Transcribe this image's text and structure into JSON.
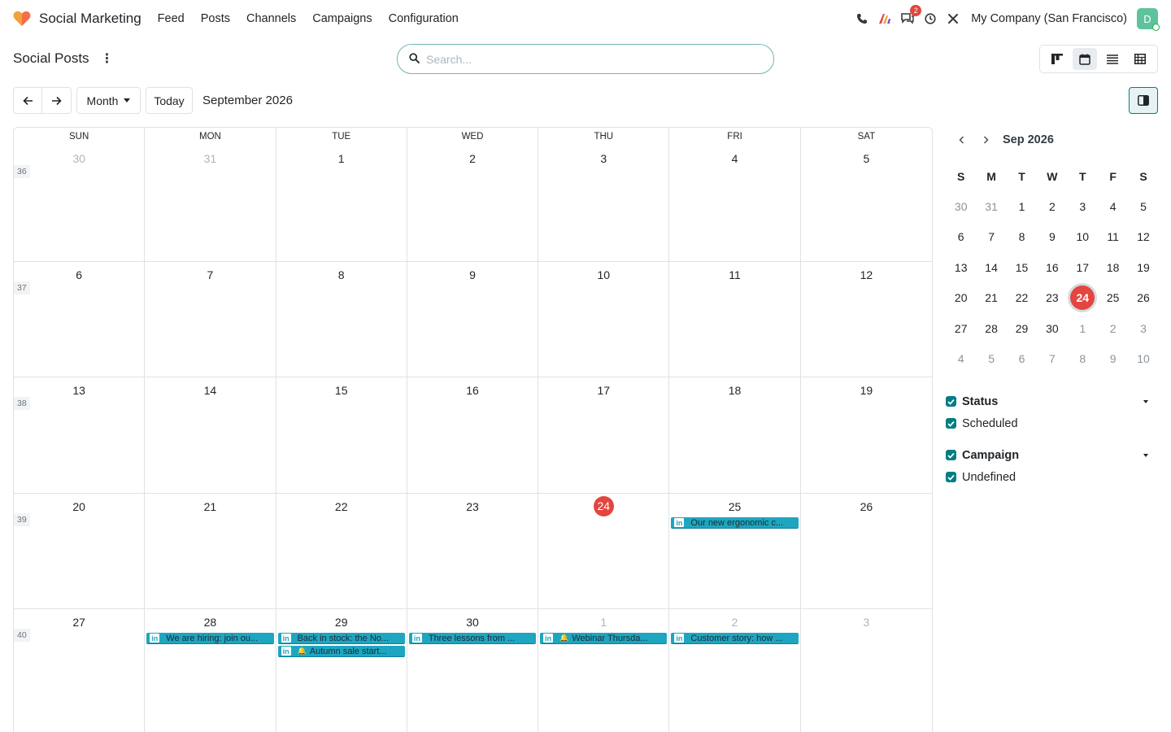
{
  "app": {
    "name": "Social Marketing",
    "menu": [
      "Feed",
      "Posts",
      "Channels",
      "Campaigns",
      "Configuration"
    ],
    "company": "My Company (San Francisco)",
    "avatar_letter": "D",
    "messages_badge": "2"
  },
  "page": {
    "title": "Social Posts",
    "search_placeholder": "Search...",
    "scale_label": "Month",
    "today_label": "Today",
    "range_title": "September 2026"
  },
  "calendar": {
    "weekdays": [
      "SUN",
      "MON",
      "TUE",
      "WED",
      "THU",
      "FRI",
      "SAT"
    ],
    "weeks": [
      {
        "number": "36",
        "days": [
          {
            "label": "30",
            "other": true
          },
          {
            "label": "31",
            "other": true
          },
          {
            "label": "1"
          },
          {
            "label": "2"
          },
          {
            "label": "3"
          },
          {
            "label": "4"
          },
          {
            "label": "5"
          }
        ]
      },
      {
        "number": "37",
        "days": [
          {
            "label": "6"
          },
          {
            "label": "7"
          },
          {
            "label": "8"
          },
          {
            "label": "9"
          },
          {
            "label": "10"
          },
          {
            "label": "11"
          },
          {
            "label": "12"
          }
        ]
      },
      {
        "number": "38",
        "days": [
          {
            "label": "13"
          },
          {
            "label": "14"
          },
          {
            "label": "15"
          },
          {
            "label": "16"
          },
          {
            "label": "17"
          },
          {
            "label": "18"
          },
          {
            "label": "19"
          }
        ]
      },
      {
        "number": "39",
        "days": [
          {
            "label": "20"
          },
          {
            "label": "21"
          },
          {
            "label": "22"
          },
          {
            "label": "23"
          },
          {
            "label": "24",
            "today": true
          },
          {
            "label": "25",
            "events": [
              {
                "text": "Our new ergonomic c..."
              }
            ]
          },
          {
            "label": "26"
          }
        ]
      },
      {
        "number": "40",
        "days": [
          {
            "label": "27"
          },
          {
            "label": "28",
            "events": [
              {
                "text": "We are hiring: join ou..."
              }
            ]
          },
          {
            "label": "29",
            "events": [
              {
                "text": "Back in stock: the No..."
              },
              {
                "text": "Autumn sale start...",
                "bell": true
              }
            ]
          },
          {
            "label": "30",
            "events": [
              {
                "text": "Three lessons from ..."
              }
            ]
          },
          {
            "label": "1",
            "other": true,
            "events": [
              {
                "text": "Webinar Thursda...",
                "bell": true
              }
            ]
          },
          {
            "label": "2",
            "other": true,
            "events": [
              {
                "text": "Customer story: how ..."
              }
            ]
          },
          {
            "label": "3",
            "other": true
          }
        ]
      }
    ]
  },
  "mini_calendar": {
    "title": "Sep 2026",
    "weekdays": [
      "S",
      "M",
      "T",
      "W",
      "T",
      "F",
      "S"
    ],
    "days": [
      {
        "l": "30",
        "o": true
      },
      {
        "l": "31",
        "o": true
      },
      {
        "l": "1"
      },
      {
        "l": "2"
      },
      {
        "l": "3"
      },
      {
        "l": "4"
      },
      {
        "l": "5"
      },
      {
        "l": "6"
      },
      {
        "l": "7"
      },
      {
        "l": "8"
      },
      {
        "l": "9"
      },
      {
        "l": "10"
      },
      {
        "l": "11"
      },
      {
        "l": "12"
      },
      {
        "l": "13"
      },
      {
        "l": "14"
      },
      {
        "l": "15"
      },
      {
        "l": "16"
      },
      {
        "l": "17"
      },
      {
        "l": "18"
      },
      {
        "l": "19"
      },
      {
        "l": "20"
      },
      {
        "l": "21"
      },
      {
        "l": "22"
      },
      {
        "l": "23"
      },
      {
        "l": "24",
        "t": true
      },
      {
        "l": "25"
      },
      {
        "l": "26"
      },
      {
        "l": "27"
      },
      {
        "l": "28"
      },
      {
        "l": "29"
      },
      {
        "l": "30"
      },
      {
        "l": "1",
        "o": true
      },
      {
        "l": "2",
        "o": true
      },
      {
        "l": "3",
        "o": true
      },
      {
        "l": "4",
        "o": true
      },
      {
        "l": "5",
        "o": true
      },
      {
        "l": "6",
        "o": true
      },
      {
        "l": "7",
        "o": true
      },
      {
        "l": "8",
        "o": true
      },
      {
        "l": "9",
        "o": true
      },
      {
        "l": "10",
        "o": true
      }
    ]
  },
  "filters": [
    {
      "title": "Status",
      "options": [
        "Scheduled"
      ]
    },
    {
      "title": "Campaign",
      "options": [
        "Undefined"
      ]
    }
  ],
  "colors": {
    "accent": "#017e84",
    "today": "#e4453f",
    "event": "#1ea6c0"
  }
}
